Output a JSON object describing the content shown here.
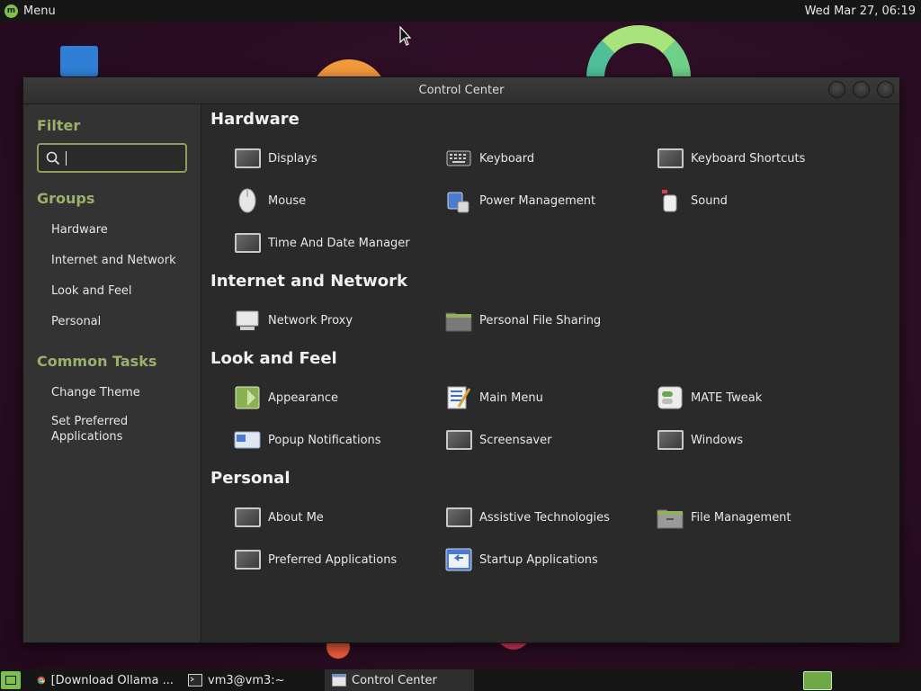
{
  "top_panel": {
    "menu_label": "Menu",
    "clock": "Wed Mar 27, 06:19"
  },
  "window": {
    "title": "Control Center"
  },
  "sidebar": {
    "filter_heading": "Filter",
    "search_value": "",
    "groups_heading": "Groups",
    "groups": [
      "Hardware",
      "Internet and Network",
      "Look and Feel",
      "Personal"
    ],
    "common_tasks_heading": "Common Tasks",
    "common_tasks": [
      "Change Theme",
      "Set Preferred Applications"
    ]
  },
  "sections": {
    "hardware": {
      "title": "Hardware",
      "items": [
        "Displays",
        "Keyboard",
        "Keyboard Shortcuts",
        "Mouse",
        "Power Management",
        "Sound",
        "Time And Date Manager"
      ]
    },
    "internet": {
      "title": "Internet and Network",
      "items": [
        "Network Proxy",
        "Personal File Sharing"
      ]
    },
    "look": {
      "title": "Look and Feel",
      "items": [
        "Appearance",
        "Main Menu",
        "MATE Tweak",
        "Popup Notifications",
        "Screensaver",
        "Windows"
      ]
    },
    "personal": {
      "title": "Personal",
      "items": [
        "About Me",
        "Assistive Technologies",
        "File Management",
        "Preferred Applications",
        "Startup Applications"
      ]
    }
  },
  "taskbar": {
    "tasks": [
      "[Download Ollama ...",
      "vm3@vm3:~",
      "Control Center"
    ]
  },
  "colors": {
    "accent_green": "#8aa05a",
    "panel_bg": "#161616",
    "window_bg": "#2a2a2a"
  }
}
